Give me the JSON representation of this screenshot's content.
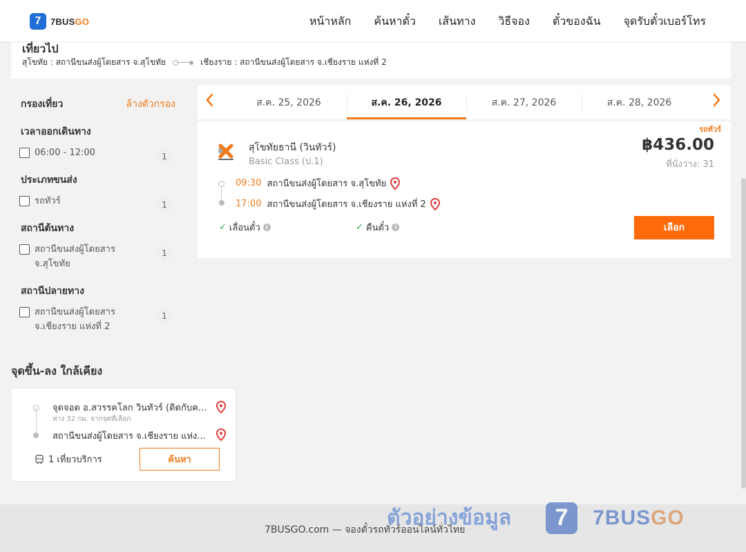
{
  "brand": {
    "name_prefix": "7BUS",
    "name_suffix": "GO",
    "badge": "7"
  },
  "nav": [
    "หน้าหลัก",
    "ค้นหาตั๋ว",
    "เส้นทาง",
    "วิธีจอง",
    "ตั๋วของฉัน",
    "จุดรับตั๋วเบอร์โทร"
  ],
  "trip": {
    "title": "เที่ยวไป",
    "origin": "สุโขทัย : สถานีขนส่งผู้โดยสาร จ.สุโขทัย",
    "destination": "เชียงราย : สถานีขนส่งผู้โดยสาร จ.เชียงราย แห่งที่ 2"
  },
  "filters": {
    "title": "กรองเที่ยว",
    "clear_label": "ล้างตัวกรอง",
    "groups": [
      {
        "title": "เวลาออกเดินทาง",
        "option": "06:00 - 12:00",
        "count": "1"
      },
      {
        "title": "ประเภทขนส่ง",
        "option": "รถทัวร์",
        "count": "1"
      },
      {
        "title": "สถานีต้นทาง",
        "option": "สถานีขนส่งผู้โดยสาร จ.สุโขทัย",
        "count": "1"
      },
      {
        "title": "สถานีปลายทาง",
        "option": "สถานีขนส่งผู้โดยสาร จ.เชียงราย แห่งที่ 2",
        "count": "1"
      }
    ]
  },
  "dates": {
    "prev_icon": "chevron-left-icon",
    "next_icon": "chevron-right-icon",
    "tabs": [
      "ส.ค. 25, 2026",
      "ส.ค. 26, 2026",
      "ส.ค. 27, 2026",
      "ส.ค. 28, 2026"
    ],
    "active_index": 1
  },
  "result": {
    "bus_type": "รถทัวร์",
    "operator": "สุโขทัยธานี (วินทัวร์)",
    "class": "Basic Class (ป.1)",
    "price": "฿436.00",
    "seats": "ที่นั่งว่าง: 31",
    "departure_time": "09:30",
    "departure_station": "สถานีขนส่งผู้โดยสาร จ.สุโขทัย",
    "arrival_time": "17:00",
    "arrival_station": "สถานีขนส่งผู้โดยสาร จ.เชียงราย แห่งที่ 2",
    "feature_1": "เลื่อนตั๋ว",
    "feature_2": "คืนตั๋ว",
    "select_label": "เลือก"
  },
  "nearby": {
    "title": "จุดขึ้น-ลง ใกล้เคียง",
    "stop_1": "จุดจอด อ.สวรรคโลก วินทัวร์ (ติดกับคลิ...",
    "stop_1_sub": "ห่าง 32 กม. จากจุดที่เลือก",
    "stop_2": "สถานีขนส่งผู้โดยสาร จ.เชียงราย แห่ง...",
    "trips": "1 เที่ยวบริการ",
    "search_label": "ค้นหา"
  },
  "footer": {
    "text": "7BUSGO.com — จองตั๋วรถทัวร์ออนไลน์ทั่วไทย"
  },
  "watermark": {
    "text": "ตัวอย่างข้อมูล",
    "brand_prefix": "7BUS",
    "brand_suffix": "GO",
    "badge": "7"
  },
  "colors": {
    "accent": "#f07a1a",
    "button": "#ff6a0a",
    "brand_blue": "#1f6fd6",
    "check": "#2eab4b",
    "pin": "#e03a3a"
  }
}
